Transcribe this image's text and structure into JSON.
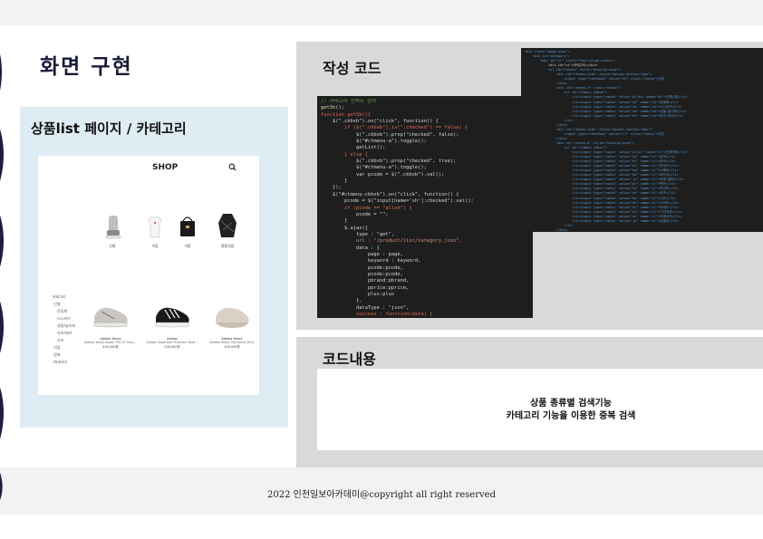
{
  "slide": {
    "title": "화면 구현",
    "left_panel_title": "상품list 페이지 / 카테고리",
    "code_label": "작성 코드",
    "desc_label": "코드내용",
    "desc_line1": "상품 종류별 검색기능",
    "desc_line2": "카테고리 기능을 이용한 중복 검색",
    "footer": "2022 인천일보아카데미@copyright all right reserved"
  },
  "shop": {
    "title": "SHOP",
    "search_icon": "search-icon",
    "categories": [
      {
        "label": "신발",
        "icon": "sneaker-icon"
      },
      {
        "label": "의류",
        "icon": "tshirt-icon"
      },
      {
        "label": "가방",
        "icon": "bag-icon"
      },
      {
        "label": "명품의류",
        "icon": "sweater-icon"
      }
    ],
    "side_categories": [
      "카테고리",
      "·신발",
      "·운동화",
      "·스니커즈",
      "·샌들/슬리퍼",
      "·부츠/워커",
      "·부츠",
      "·의류",
      "·잡화",
      "·액세서리"
    ],
    "products": [
      {
        "brand": "Adidas Yeezy",
        "name": "Adidas Yeezy Boost 700 V2 Toon...",
        "price": "400,000원"
      },
      {
        "brand": "Adidas",
        "name": "Adidas Superstar Premium Boot...",
        "price": "200,000원"
      },
      {
        "brand": "Adidas Yeezy",
        "name": "Adidas Yeezy 500 Bone 2022",
        "price": "400,000원"
      }
    ]
  },
  "code1": [
    {
      "t": "// 카테고리 선택시 검색",
      "c": "#6a9955"
    },
    {
      "t": "getSh();",
      "c": "#dcdcaa"
    },
    {
      "t": "function getSh(){",
      "c": "#e06c4c"
    },
    {
      "t": "    $(\".ckbxb\").on(\"click\", function() {",
      "c": "#d4d4d4"
    },
    {
      "t": "        if ($(\".ckbxb\").is(\":checked\") == false) {",
      "c": "#e06c4c"
    },
    {
      "t": "            $(\".ckbxb\").prop(\"checked\", false);",
      "c": "#d4d4d4"
    },
    {
      "t": "            $(\"#ctmenu-a\").toggle();",
      "c": "#d4d4d4"
    },
    {
      "t": "            getList();",
      "c": "#d4d4d4"
    },
    {
      "t": "        } else {",
      "c": "#e06c4c"
    },
    {
      "t": "            $(\".ckbxb\").prop(\"checked\", true);",
      "c": "#d4d4d4"
    },
    {
      "t": "            $(\"#ctmenu-a\").toggle();",
      "c": "#d4d4d4"
    },
    {
      "t": "            var pcode = $(\".ckbxb\").val();",
      "c": "#d4d4d4"
    },
    {
      "t": "        }",
      "c": "#d4d4d4"
    },
    {
      "t": "    });",
      "c": "#d4d4d4"
    },
    {
      "t": "    $(\"#ctmenu-ckbxb\").on(\"click\", function() {",
      "c": "#d4d4d4"
    },
    {
      "t": "        pcode = $(\"input[name='sh']:checked\").val();",
      "c": "#d4d4d4"
    },
    {
      "t": "        if (pcode == \"allsh\") {",
      "c": "#e06c4c"
    },
    {
      "t": "            pcode = \"\";",
      "c": "#d4d4d4"
    },
    {
      "t": "        }",
      "c": "#d4d4d4"
    },
    {
      "t": "",
      "c": "#d4d4d4"
    },
    {
      "t": "        $.ajax({",
      "c": "#d4d4d4"
    },
    {
      "t": "            type : \"get\",",
      "c": "#d4d4d4"
    },
    {
      "t": "            url : \"/product/list/category.json\",",
      "c": "#ce9178"
    },
    {
      "t": "            data : {",
      "c": "#d4d4d4"
    },
    {
      "t": "                page : page,",
      "c": "#d4d4d4"
    },
    {
      "t": "                keyword : keyword,",
      "c": "#d4d4d4"
    },
    {
      "t": "                pcode:pcode,",
      "c": "#d4d4d4"
    },
    {
      "t": "                pcode:pcode,",
      "c": "#d4d4d4"
    },
    {
      "t": "                pbrand:pbrand,",
      "c": "#d4d4d4"
    },
    {
      "t": "                pprice:pprice,",
      "c": "#d4d4d4"
    },
    {
      "t": "                plus:plus",
      "c": "#d4d4d4"
    },
    {
      "t": "            },",
      "c": "#d4d4d4"
    },
    {
      "t": "            dataType : \"json\",",
      "c": "#d4d4d4"
    },
    {
      "t": "            success : function(data) {",
      "c": "#e06c4c"
    }
  ],
  "code2": [
    {
      "t": "<div class=\"page-wrap\">",
      "c": "#569cd6"
    },
    {
      "t": "    <div id=\"category\">",
      "c": "#569cd6"
    },
    {
      "t": "        <div id=\"ct\" style=\"text-align:center\">",
      "c": "#569cd6"
    },
    {
      "t": "            <div id=\"ct\">카테고리</div>",
      "c": "#d4d4d4"
    },
    {
      "t": "            <ul id=\"ctmenu\" style=\"display:none\">",
      "c": "#569cd6"
    },
    {
      "t": "                <div id=\"ctmenu-ckbx\" style=\"margin-bottom:10px\">",
      "c": "#569cd6"
    },
    {
      "t": "                    <input type=\"checkbox\" value=\"sh\" class=\"ckbxb\">신발",
      "c": "#569cd6"
    },
    {
      "t": "                </div>",
      "c": "#569cd6"
    },
    {
      "t": "                <div id=\"ctmenu-a\" class=\"ctbox\">",
      "c": "#569cd6"
    },
    {
      "t": "                    <ul id=\"ctmenu-ckbxb\">",
      "c": "#569cd6"
    },
    {
      "t": "                        <li><input type=\"radio\" value=\"allsh\" name=\"sh\">전체신발</li>",
      "c": "#569cd6"
    },
    {
      "t": "                        <li><input type=\"radio\" value=\"sn\" name=\"sh\">운동화</li>",
      "c": "#569cd6"
    },
    {
      "t": "                        <li><input type=\"radio\" value=\"sk\" name=\"sh\">스니커즈</li>",
      "c": "#569cd6"
    },
    {
      "t": "                        <li><input type=\"radio\" value=\"sd\" name=\"sh\">샌들/슬리퍼</li>",
      "c": "#569cd6"
    },
    {
      "t": "                        <li><input type=\"radio\" value=\"bt\" name=\"sh\">부츠/워커</li>",
      "c": "#569cd6"
    },
    {
      "t": "                    </ul>",
      "c": "#569cd6"
    },
    {
      "t": "                </div>",
      "c": "#569cd6"
    },
    {
      "t": "                <div id=\"ctmenu-ckbx\" style=\"margin-bottom:10px\">",
      "c": "#569cd6"
    },
    {
      "t": "                    <input type=\"checkbox\" value=\"cl\" class=\"ckbxc\">의류",
      "c": "#569cd6"
    },
    {
      "t": "                </div>",
      "c": "#569cd6"
    },
    {
      "t": "                <div id=\"ctmenu-b\" style=\"display:none\">",
      "c": "#569cd6"
    },
    {
      "t": "                    <ul id=\"ctmenu-ckbxc\">",
      "c": "#569cd6"
    },
    {
      "t": "                        <li><input type=\"radio\" value=\"allcl\" name=\"cl\">전체의류</li>",
      "c": "#569cd6"
    },
    {
      "t": "                        <li><input type=\"radio\" value=\"tp\" name=\"cl\">상의</li>",
      "c": "#569cd6"
    },
    {
      "t": "                        <li><input type=\"radio\" value=\"bt\" name=\"cl\">하의</li>",
      "c": "#569cd6"
    },
    {
      "t": "                        <li><input type=\"radio\" value=\"ot\" name=\"cl\">아우터</li>",
      "c": "#569cd6"
    },
    {
      "t": "                        <li><input type=\"radio\" value=\"sw\" name=\"cl\">스웨터</li>",
      "c": "#569cd6"
    },
    {
      "t": "                        <li><input type=\"radio\" value=\"hd\" name=\"cl\">후드티</li>",
      "c": "#569cd6"
    },
    {
      "t": "                        <li><input type=\"radio\" value=\"jk\" name=\"cl\">자켓/점퍼</li>",
      "c": "#569cd6"
    },
    {
      "t": "                        <li><input type=\"radio\" value=\"pt\" name=\"cl\">팬츠</li>",
      "c": "#569cd6"
    },
    {
      "t": "                        <li><input type=\"radio\" value=\"ts\" name=\"cl\">티셔츠</li>",
      "c": "#569cd6"
    },
    {
      "t": "                        <li><input type=\"radio\" value=\"sh\" name=\"cl\">셔츠</li>",
      "c": "#569cd6"
    },
    {
      "t": "                        <li><input type=\"radio\" value=\"kn\" name=\"cl\">니트</li>",
      "c": "#569cd6"
    },
    {
      "t": "                        <li><input type=\"radio\" value=\"sk\" name=\"cl\">스커트</li>",
      "c": "#569cd6"
    },
    {
      "t": "                        <li><input type=\"radio\" value=\"dr\" name=\"cl\">드레스</li>",
      "c": "#569cd6"
    },
    {
      "t": "                        <li><input type=\"radio\" value=\"et\" name=\"cl\">기타의류</li>",
      "c": "#569cd6"
    },
    {
      "t": "                        <li><input type=\"radio\" value=\"ac\" name=\"cl\">액세서리</li>",
      "c": "#569cd6"
    },
    {
      "t": "                        <li><input type=\"radio\" value=\"jw\" name=\"cl\">쥬얼리</li>",
      "c": "#569cd6"
    },
    {
      "t": "                    </ul>",
      "c": "#569cd6"
    },
    {
      "t": "                </div>",
      "c": "#569cd6"
    }
  ]
}
